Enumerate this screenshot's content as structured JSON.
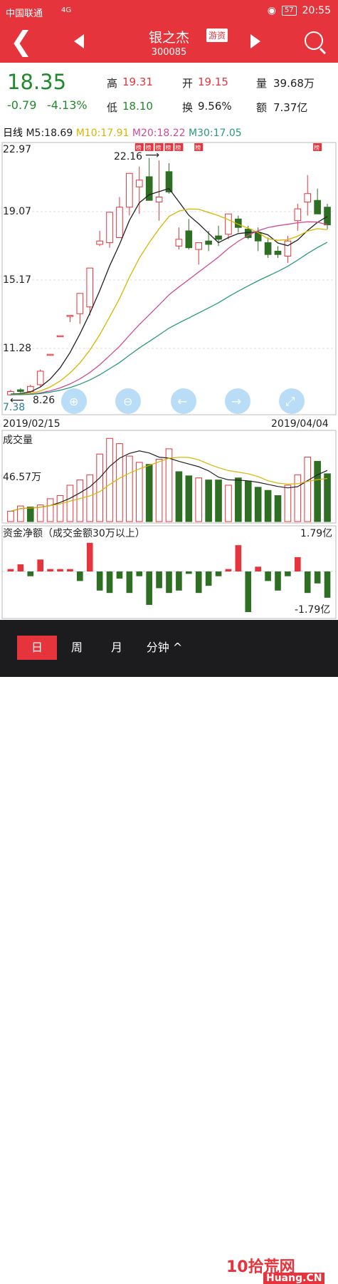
{
  "status": {
    "carrier": "中国联通",
    "signal": "4G",
    "battery": "57",
    "time": "20:55"
  },
  "header": {
    "title": "银之杰",
    "code": "300085",
    "badge": "游资"
  },
  "quote": {
    "price": "18.35",
    "change": "-0.79",
    "change_pct": "-4.13%",
    "high_label": "高",
    "high": "19.31",
    "open_label": "开",
    "open": "19.15",
    "volume_label": "量",
    "volume": "39.68万",
    "low_label": "低",
    "low": "18.10",
    "turnover_label": "换",
    "turnover": "9.56%",
    "amount_label": "额",
    "amount": "7.37亿"
  },
  "ma": {
    "period_label": "日线",
    "m5": "M5:18.69",
    "m10": "M10:17.91",
    "m20": "M20:18.22",
    "m30": "M30:17.05",
    "colors": {
      "m5": "#222222",
      "m10": "#d9b500",
      "m20": "#d04c94",
      "m30": "#2a9a7c"
    }
  },
  "kline": {
    "y_top": "22.97",
    "y_mid1": "19.07",
    "y_mid2": "15.17",
    "y_mid3": "11.28",
    "y_bottom": "7.38",
    "max_annotation": "22.16",
    "min_annotation": "8.26",
    "date_start": "2019/02/15",
    "date_end": "2019/04/04",
    "board_tag": "榜"
  },
  "volume": {
    "label": "成交量",
    "y_label": "46.57万"
  },
  "capital": {
    "label": "资金净额（成交金额30万以上）",
    "y_top": "1.79亿",
    "y_bottom": "-1.79亿"
  },
  "tabs": [
    "日",
    "周",
    "月",
    "分钟 ^"
  ],
  "watermark": {
    "text": "10拾荒网",
    "sub": "Huang.CN"
  },
  "colors": {
    "up": "#e5343b",
    "down": "#2e6f24"
  },
  "chart_data": {
    "type": "candlestick",
    "x": [
      "2019/02/15",
      "",
      "",
      "",
      "",
      "",
      "",
      "",
      "",
      "",
      "",
      "",
      "",
      "",
      "",
      "",
      "",
      "",
      "",
      "",
      "",
      "",
      "",
      "",
      "",
      "",
      "",
      "",
      "",
      "",
      "",
      "",
      "",
      "",
      "2019/04/04"
    ],
    "ohlc": [
      [
        8.3,
        8.6,
        8.26,
        8.5
      ],
      [
        8.6,
        8.7,
        8.4,
        8.5
      ],
      [
        8.5,
        8.9,
        8.4,
        8.8
      ],
      [
        8.9,
        9.8,
        8.8,
        9.7
      ],
      [
        10.7,
        10.7,
        10.7,
        10.7
      ],
      [
        11.8,
        11.8,
        11.8,
        11.8
      ],
      [
        13.0,
        13.0,
        12.6,
        13.0
      ],
      [
        13.1,
        14.3,
        12.5,
        14.3
      ],
      [
        13.5,
        15.8,
        13.0,
        15.8
      ],
      [
        17.2,
        18.0,
        17.1,
        17.4
      ],
      [
        17.3,
        19.1,
        17.0,
        19.1
      ],
      [
        17.6,
        20.0,
        17.6,
        19.4
      ],
      [
        19.4,
        21.4,
        18.9,
        21.4
      ],
      [
        20.6,
        21.8,
        19.0,
        21.0
      ],
      [
        21.2,
        22.3,
        20.0,
        19.8
      ],
      [
        19.7,
        22.16,
        18.6,
        20.0
      ],
      [
        21.5,
        22.0,
        20.2,
        20.3
      ],
      [
        17.1,
        18.2,
        16.9,
        17.5
      ],
      [
        18.0,
        18.7,
        16.9,
        17.0
      ],
      [
        16.9,
        17.2,
        16.0,
        17.3
      ],
      [
        17.4,
        18.0,
        16.8,
        17.2
      ],
      [
        17.7,
        18.3,
        17.1,
        17.5
      ],
      [
        17.8,
        19.0,
        17.5,
        19.0
      ],
      [
        18.7,
        18.9,
        17.9,
        18.2
      ],
      [
        18.1,
        18.3,
        17.5,
        17.6
      ],
      [
        17.9,
        18.2,
        16.8,
        17.4
      ],
      [
        17.3,
        17.6,
        16.4,
        16.6
      ],
      [
        16.8,
        17.1,
        16.4,
        16.6
      ],
      [
        16.5,
        17.7,
        16.1,
        17.4
      ],
      [
        18.6,
        19.6,
        18.0,
        19.3
      ],
      [
        19.7,
        21.3,
        18.9,
        20.2
      ],
      [
        19.8,
        20.5,
        19.0,
        19.0
      ],
      [
        19.4,
        19.6,
        18.1,
        18.35
      ]
    ],
    "volume_up": [
      true,
      true,
      false,
      true,
      true,
      true,
      true,
      true,
      true,
      true,
      true,
      true,
      true,
      true,
      false,
      true,
      true,
      false,
      false,
      true,
      false,
      false,
      true,
      false,
      false,
      false,
      false,
      false,
      true,
      true,
      true,
      false,
      false
    ],
    "volume": [
      10,
      15,
      14,
      16,
      22,
      25,
      35,
      40,
      45,
      65,
      80,
      75,
      63,
      57,
      55,
      60,
      70,
      48,
      44,
      42,
      40,
      40,
      35,
      42,
      39,
      33,
      30,
      25,
      35,
      45,
      62,
      58,
      46
    ],
    "capital": [
      0.1,
      0.3,
      -0.2,
      0.5,
      0.1,
      0.1,
      0.1,
      -0.4,
      1.2,
      -0.8,
      -0.9,
      -0.3,
      -0.9,
      -0.2,
      -1.4,
      -0.7,
      -0.9,
      -0.8,
      -0.1,
      -0.9,
      -0.6,
      -0.2,
      0.1,
      1.1,
      -1.7,
      0.2,
      -0.4,
      -0.8,
      -0.2,
      0.6,
      -0.9,
      -0.5,
      -1.1
    ],
    "ylim": [
      7.38,
      22.97
    ]
  }
}
